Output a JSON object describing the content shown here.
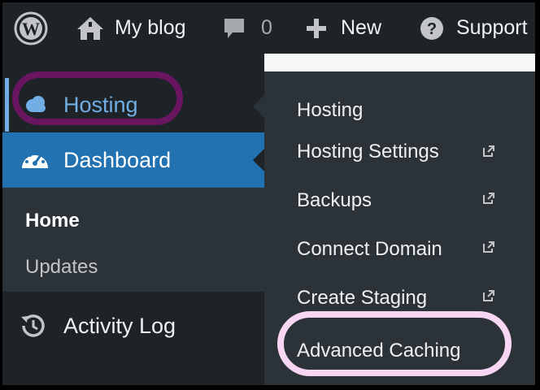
{
  "adminbar": {
    "site_name": "My blog",
    "comments_count": "0",
    "new_label": "New",
    "support_label": "Support"
  },
  "sidebar": {
    "items": [
      {
        "label": "Hosting",
        "icon": "cloud-icon",
        "state": "open-flyout"
      },
      {
        "label": "Dashboard",
        "icon": "dashboard-gauge-icon",
        "state": "current"
      },
      {
        "label": "Activity Log",
        "icon": "history-icon"
      }
    ],
    "submenu": [
      {
        "label": "Home",
        "state": "current"
      },
      {
        "label": "Updates"
      }
    ]
  },
  "flyout": {
    "items": [
      {
        "label": "Hosting",
        "external": false
      },
      {
        "label": "Hosting Settings",
        "external": true
      },
      {
        "label": "Backups",
        "external": true
      },
      {
        "label": "Connect Domain",
        "external": true
      },
      {
        "label": "Create Staging",
        "external": true
      },
      {
        "label": "Advanced Caching",
        "external": false
      }
    ]
  },
  "colors": {
    "adminbar_bg": "#1d2327",
    "menu_highlight": "#2271b1",
    "hosting_link": "#72aee6",
    "flyout_bg": "#2c3338",
    "hosting_oval": "#6a1560",
    "caching_oval": "#f7d6f3"
  }
}
